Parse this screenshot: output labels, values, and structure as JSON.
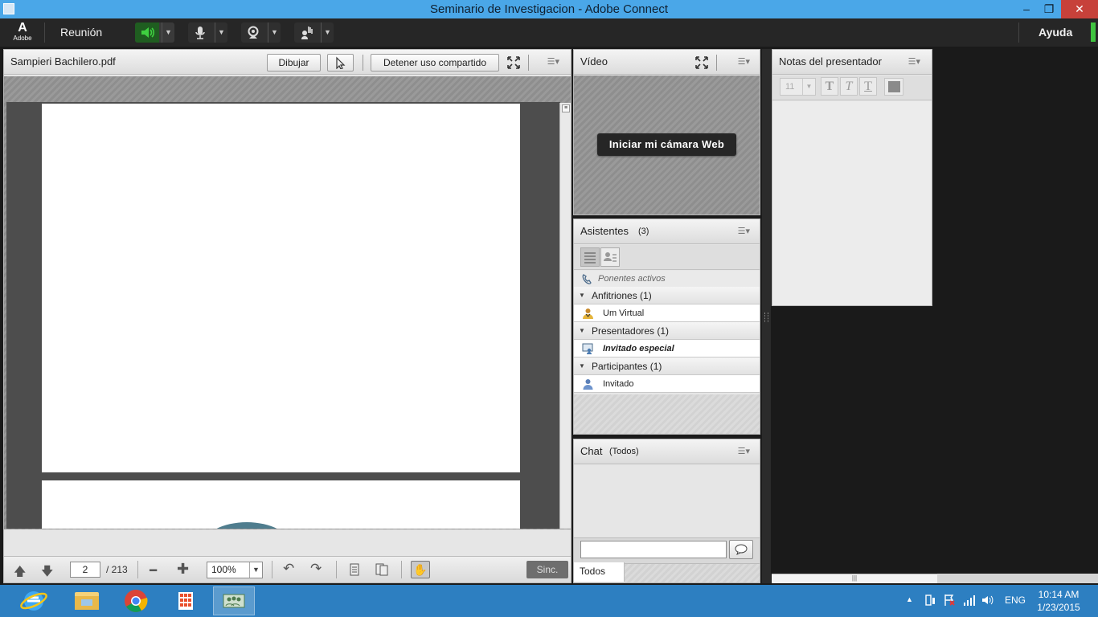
{
  "window": {
    "title": "Seminario de Investigacion - Adobe Connect",
    "minimize": "–",
    "restore": "❐",
    "close": "✕"
  },
  "toolbar": {
    "adobe_logo_text": "Adobe",
    "menu_meeting": "Reunión",
    "menu_help": "Ayuda",
    "speaker_icon": "speaker-icon",
    "mic_icon": "microphone-icon",
    "webcam_icon": "webcam-icon",
    "raise_hand_icon": "raise-hand-icon",
    "speaker_active_color": "#22a83a"
  },
  "share_pod": {
    "filename": "Sampieri Bachilero.pdf",
    "draw_button": "Dibujar",
    "stop_sharing_button": "Detener uso compartido",
    "current_page": "2",
    "page_total": "/ 213",
    "zoom": "100%",
    "sync_button": "Sinc."
  },
  "video_pod": {
    "title": "Vídeo",
    "start_webcam_button": "Iniciar mi cámara Web"
  },
  "attendees_pod": {
    "title": "Asistentes",
    "count": "(3)",
    "active_speakers": "Ponentes activos",
    "groups": [
      {
        "label": "Anfitriones (1)",
        "member": "Um Virtual",
        "member_icon": "host-icon"
      },
      {
        "label": "Presentadores (1)",
        "member": "Invitado especial",
        "member_icon": "presenter-icon"
      },
      {
        "label": "Participantes (1)",
        "member": "Invitado",
        "member_icon": "participant-icon"
      }
    ]
  },
  "chat_pod": {
    "title": "Chat",
    "scope": "(Todos)",
    "tab_all": "Todos"
  },
  "notes_pod": {
    "title": "Notas del presentador",
    "font_size": "11"
  },
  "taskbar": {
    "language": "ENG",
    "time": "10:14 AM",
    "date": "1/23/2015"
  }
}
